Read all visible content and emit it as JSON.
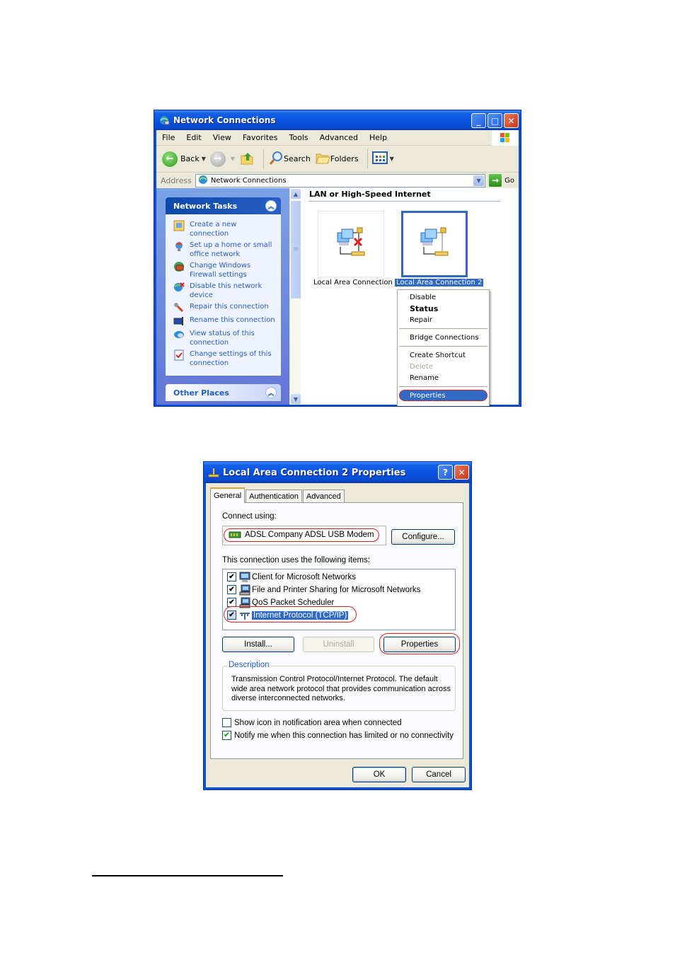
{
  "network_connections": {
    "title": "Network Connections",
    "menu": [
      "File",
      "Edit",
      "View",
      "Favorites",
      "Tools",
      "Advanced",
      "Help"
    ],
    "toolbar": {
      "back_label": "Back",
      "search_label": "Search",
      "folders_label": "Folders"
    },
    "address": {
      "label": "Address",
      "value": "Network Connections",
      "go_label": "Go"
    },
    "sidebar": {
      "network_tasks_title": "Network Tasks",
      "tasks": [
        {
          "label": "Create a new connection",
          "icon": "new-connection-icon"
        },
        {
          "label": "Set up a home or small office network",
          "icon": "home-network-icon"
        },
        {
          "label": "Change Windows Firewall settings",
          "icon": "firewall-icon"
        },
        {
          "label": "Disable this network device",
          "icon": "disable-network-icon"
        },
        {
          "label": "Repair this connection",
          "icon": "repair-wrench-icon"
        },
        {
          "label": "Rename this connection",
          "icon": "rename-icon"
        },
        {
          "label": "View status of this connection",
          "icon": "status-icon"
        },
        {
          "label": "Change settings of this connection",
          "icon": "settings-checklist-icon"
        }
      ],
      "other_places_title": "Other Places"
    },
    "content": {
      "group_header": "LAN or High-Speed Internet",
      "connections": [
        {
          "label": "Local Area Connection",
          "state": "disconnected",
          "selected": false
        },
        {
          "label": "Local Area Connection 2",
          "state": "connected",
          "selected": true
        }
      ]
    },
    "context_menu": {
      "items": [
        {
          "label": "Disable"
        },
        {
          "label": "Status",
          "bold": true
        },
        {
          "label": "Repair"
        },
        {
          "label": "Bridge Connections"
        },
        {
          "label": "Create Shortcut"
        },
        {
          "label": "Delete",
          "disabled": true
        },
        {
          "label": "Rename"
        },
        {
          "label": "Properties",
          "highlighted": true
        }
      ]
    }
  },
  "properties_dialog": {
    "title": "Local Area Connection 2 Properties",
    "tabs": [
      "General",
      "Authentication",
      "Advanced"
    ],
    "active_tab": "General",
    "connect_using_label": "Connect using:",
    "device": "ADSL Company ADSL USB Modem",
    "configure_label": "Configure...",
    "items_label": "This connection uses the following items:",
    "items": [
      {
        "label": "Client for Microsoft Networks",
        "checked": true,
        "selected": false
      },
      {
        "label": "File and Printer Sharing for Microsoft Networks",
        "checked": true,
        "selected": false
      },
      {
        "label": "QoS Packet Scheduler",
        "checked": true,
        "selected": false
      },
      {
        "label": "Internet Protocol (TCP/IP)",
        "checked": true,
        "selected": true
      }
    ],
    "install_label": "Install...",
    "uninstall_label": "Uninstall",
    "properties_label": "Properties",
    "description_title": "Description",
    "description_text": "Transmission Control Protocol/Internet Protocol. The default wide area network protocol that provides communication across diverse interconnected networks.",
    "show_icon_label": "Show icon in notification area when connected",
    "show_icon_checked": false,
    "notify_label": "Notify me when this connection has limited or no connectivity",
    "notify_checked": true,
    "ok_label": "OK",
    "cancel_label": "Cancel"
  },
  "colors": {
    "xp_blue": "#0a50d8",
    "selection": "#316ac5",
    "task_link": "#215dc6",
    "annotation_red": "#e02020"
  }
}
